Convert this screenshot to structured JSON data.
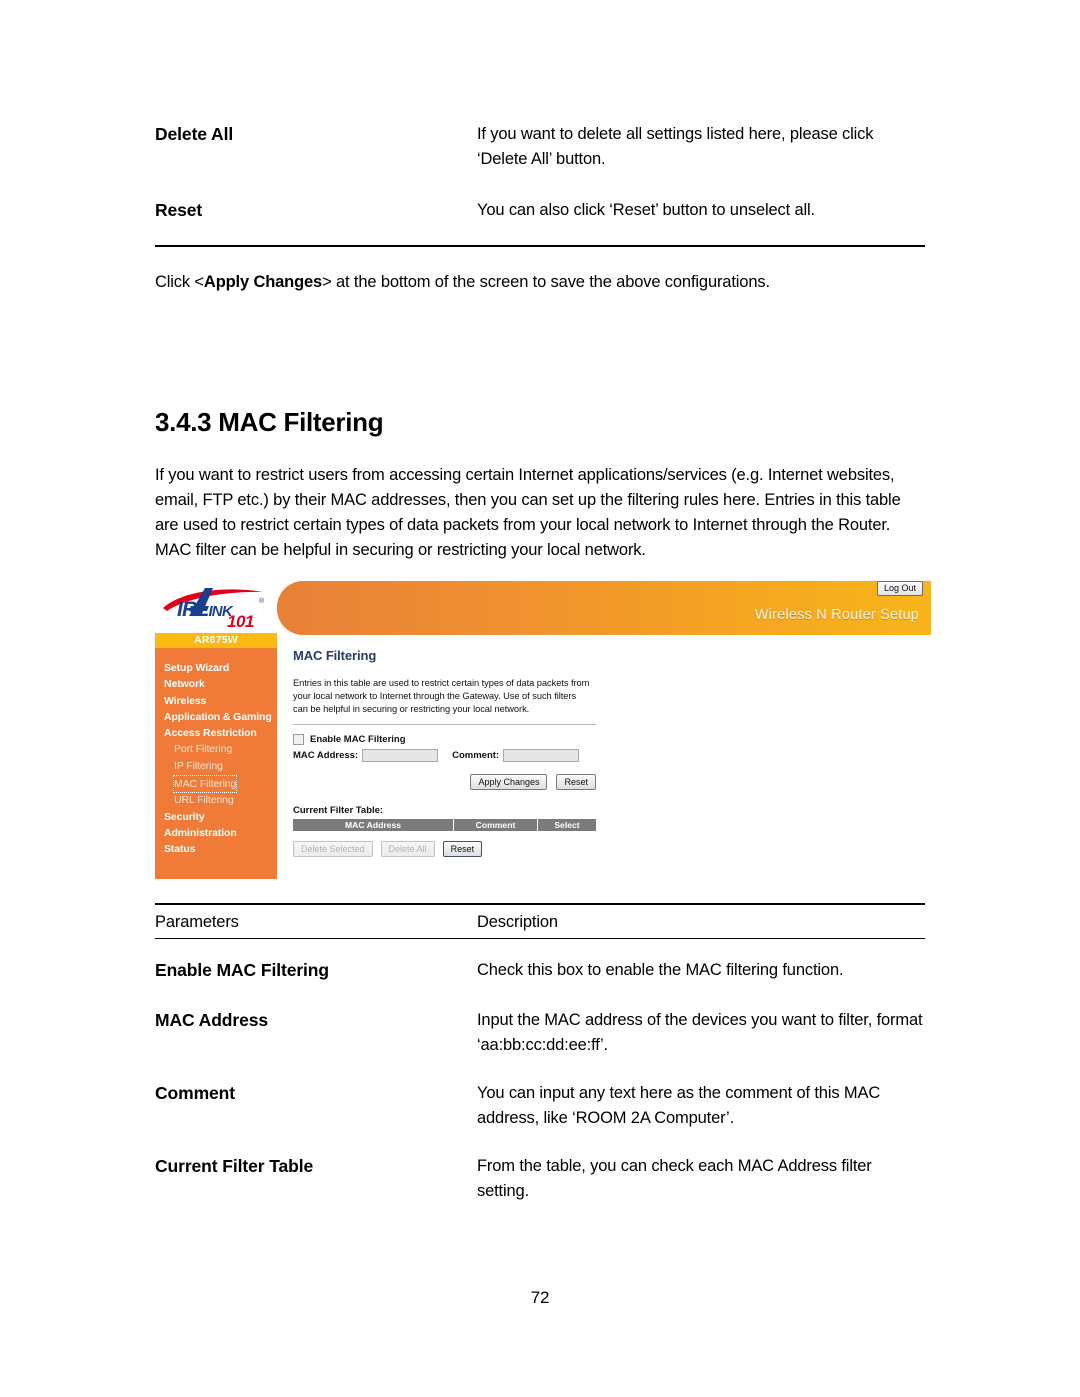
{
  "document": {
    "page_number": "72",
    "top_params": [
      {
        "name": "Delete All",
        "desc": "If you want to delete all settings listed here, please click ‘Delete All’ button."
      },
      {
        "name": "Reset",
        "desc": "You can also click ‘Reset’ button to unselect all."
      }
    ],
    "apply_note": {
      "pre": "Click <",
      "bold": "Apply Changes",
      "post": "> at the bottom of the screen to save the above configurations."
    },
    "section": {
      "title": "3.4.3 MAC Filtering",
      "intro": "If you want to restrict users from accessing certain Internet applications/services (e.g. Internet websites, email, FTP etc.) by their MAC addresses, then you can set up the filtering rules here. Entries in this table are used to restrict certain types of data packets from your local network to Internet through the Router. MAC filter can be helpful in securing or restricting your local network."
    },
    "param_table": {
      "headers": {
        "parameters": "Parameters",
        "description": "Description"
      },
      "rows": [
        {
          "name": "Enable MAC Filtering",
          "desc": "Check this box to enable the MAC filtering function."
        },
        {
          "name": "MAC Address",
          "desc": "Input the MAC address of the devices you want to filter, format ‘aa:bb:cc:dd:ee:ff’."
        },
        {
          "name": "Comment",
          "desc": "You can input any text here as the comment of this MAC address, like ‘ROOM 2A Computer’."
        },
        {
          "name": "Current Filter Table",
          "desc": "From the table, you can check each MAC Address filter setting."
        }
      ]
    }
  },
  "router_ui": {
    "brand": {
      "logo_a": "A",
      "logo_text": "IR",
      "logo_text2": "L",
      "logo_text3": "INK",
      "logo_reg": "®",
      "logo_101": "101",
      "model": "AR675W"
    },
    "header": {
      "title": "Wireless N Router Setup",
      "logout_label": "Log Out"
    },
    "sidebar": {
      "items": [
        {
          "label": "Setup Wizard",
          "type": "top",
          "active": false
        },
        {
          "label": "Network",
          "type": "top",
          "active": false
        },
        {
          "label": "Wireless",
          "type": "top",
          "active": false
        },
        {
          "label": "Application & Gaming",
          "type": "top",
          "active": false
        },
        {
          "label": "Access Restriction",
          "type": "top",
          "active": false
        },
        {
          "label": "Port Filtering",
          "type": "sub",
          "active": false
        },
        {
          "label": "IP Filtering",
          "type": "sub",
          "active": false
        },
        {
          "label": "MAC Filtering",
          "type": "sub",
          "active": true
        },
        {
          "label": "URL Filtering",
          "type": "sub",
          "active": false
        },
        {
          "label": "Security",
          "type": "top",
          "active": false
        },
        {
          "label": "Administration",
          "type": "top",
          "active": false
        },
        {
          "label": "Status",
          "type": "top",
          "active": false
        }
      ]
    },
    "panel": {
      "title": "MAC Filtering",
      "description": "Entries in this table are used to restrict certain types of data packets from your local network to Internet through the Gateway. Use of such filters can be helpful in securing or restricting your local network.",
      "enable_checkbox_label": "Enable MAC Filtering",
      "mac_address_label": "MAC Address:",
      "mac_address_value": "",
      "comment_label": "Comment:",
      "comment_value": "",
      "apply_changes_label": "Apply Changes",
      "reset_label": "Reset",
      "current_filter_table_label": "Current Filter Table:",
      "table_headers": [
        "MAC Address",
        "Comment",
        "Select"
      ],
      "table_rows": [],
      "delete_selected_label": "Delete Selected",
      "delete_all_label": "Delete All",
      "bottom_reset_label": "Reset"
    },
    "colors": {
      "sidebar_orange": "#f07b38",
      "model_bar_yellow": "#fdb913",
      "header_gradient_start": "#e8813a",
      "header_gradient_end": "#f8b51a",
      "panel_title_navy": "#2b3a6b",
      "table_header_gray": "#7b7b7b",
      "logo_blue": "#1b3f8f",
      "logo_red": "#e2001a"
    }
  }
}
